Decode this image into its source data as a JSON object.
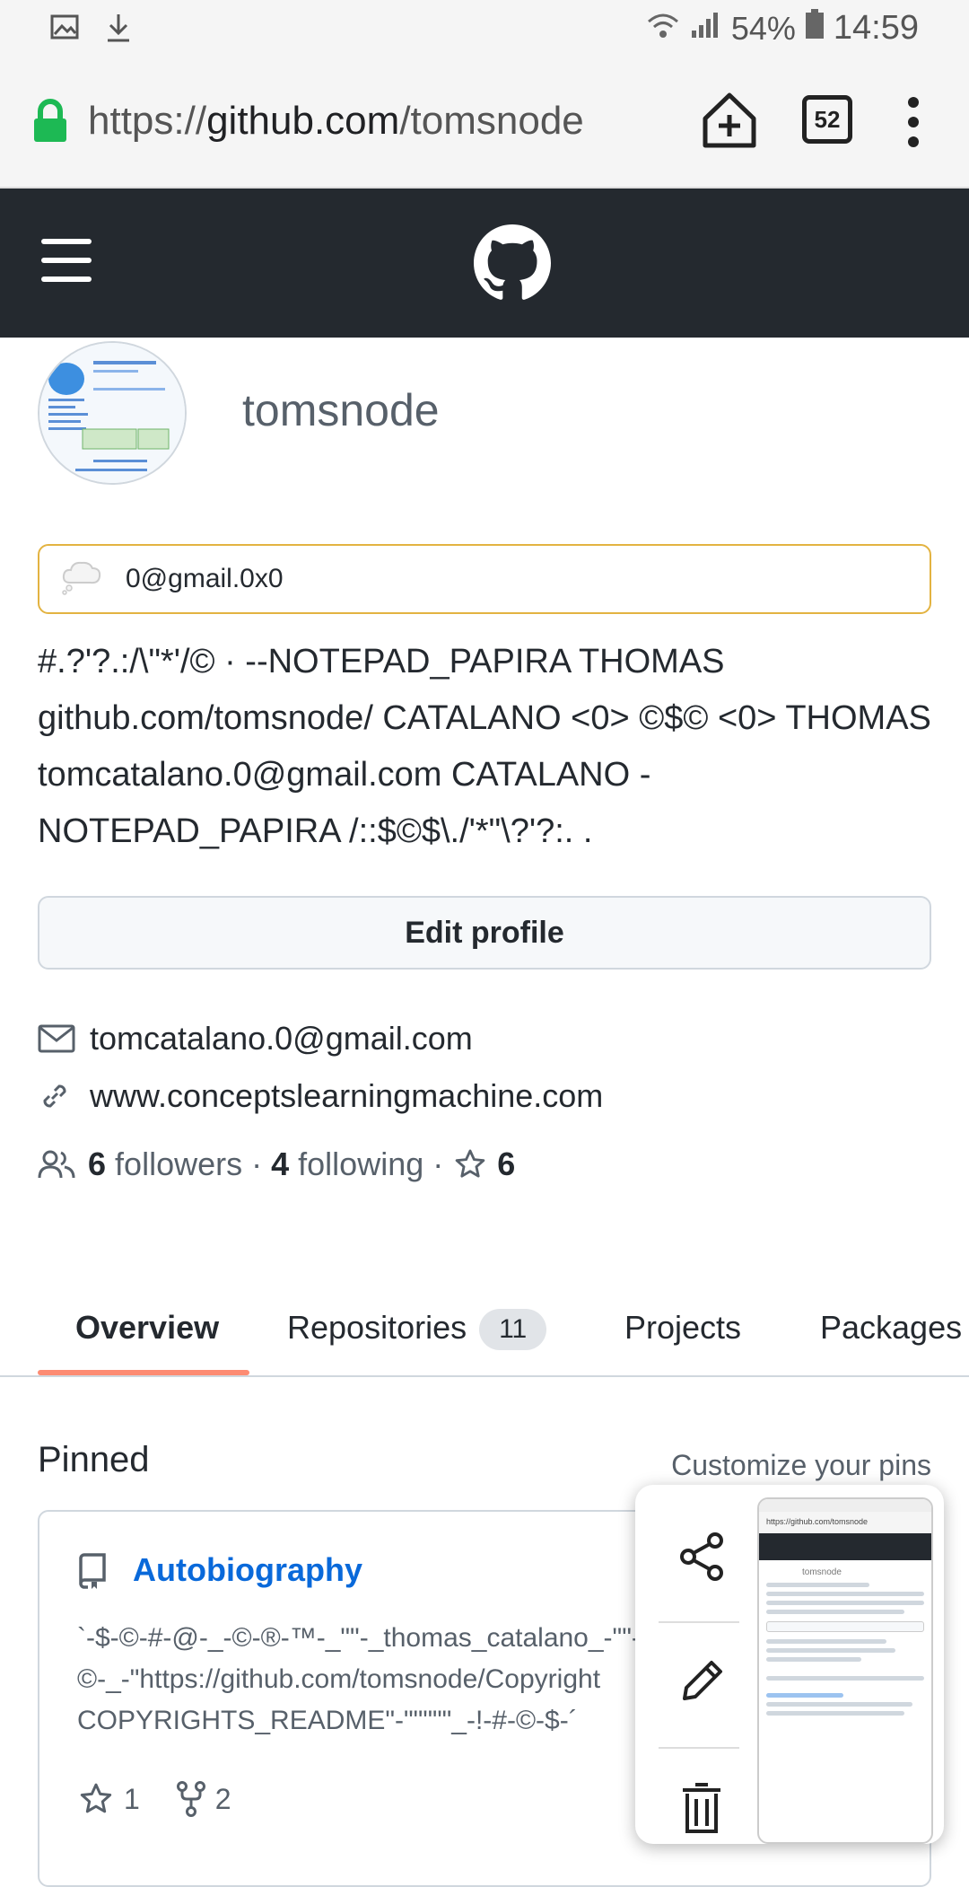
{
  "status_bar": {
    "battery": "54%",
    "time": "14:59"
  },
  "browser": {
    "url_scheme": "https://",
    "url_host": "github.com",
    "url_path": "/tomsnode",
    "tab_count": "52"
  },
  "profile": {
    "username": "tomsnode",
    "status_text": "0@gmail.0x0",
    "bio": "#.?'?.:/\\\"*'/© · --NOTEPAD_PAPIRA THOMAS github.com/tomsnode/ CATALANO <0> ©$© <0> THOMAS tomcatalano.0@gmail.com CATALANO -NOTEPAD_PAPIRA /::$©$\\./'*\"\\?'?:. .",
    "edit_button": "Edit profile",
    "email": "tomcatalano.0@gmail.com",
    "website": "www.conceptslearningmachine.com",
    "followers_count": "6",
    "followers_label": "followers",
    "following_count": "4",
    "following_label": "following",
    "stars_count": "6",
    "separator": "·"
  },
  "tabs": [
    {
      "label": "Overview",
      "active": true
    },
    {
      "label": "Repositories",
      "count": "11"
    },
    {
      "label": "Projects"
    },
    {
      "label": "Packages"
    }
  ],
  "pinned": {
    "title": "Pinned",
    "customize": "Customize your pins",
    "repo": {
      "name": "Autobiography",
      "desc_line1": "`-$-©-#-@-_-©-®-™-_\"\"-_thomas_catalano_-\"\"-_-",
      "desc_line2": "©-_-\"https://github.com/tomsnode/Copyright",
      "desc_line3": "COPYRIGHTS_README\"-\"\"\"\"\"_-!-#-©-$-´",
      "stars": "1",
      "forks": "2"
    }
  },
  "overlay": {
    "thumb_url": "https://github.com/tomsnode",
    "thumb_username": "tomsnode"
  },
  "colors": {
    "header_bg": "#24292f",
    "link_blue": "#0969da",
    "tab_accent": "#fd8c73",
    "status_border": "#e3b341",
    "lock_green": "#1db954"
  }
}
